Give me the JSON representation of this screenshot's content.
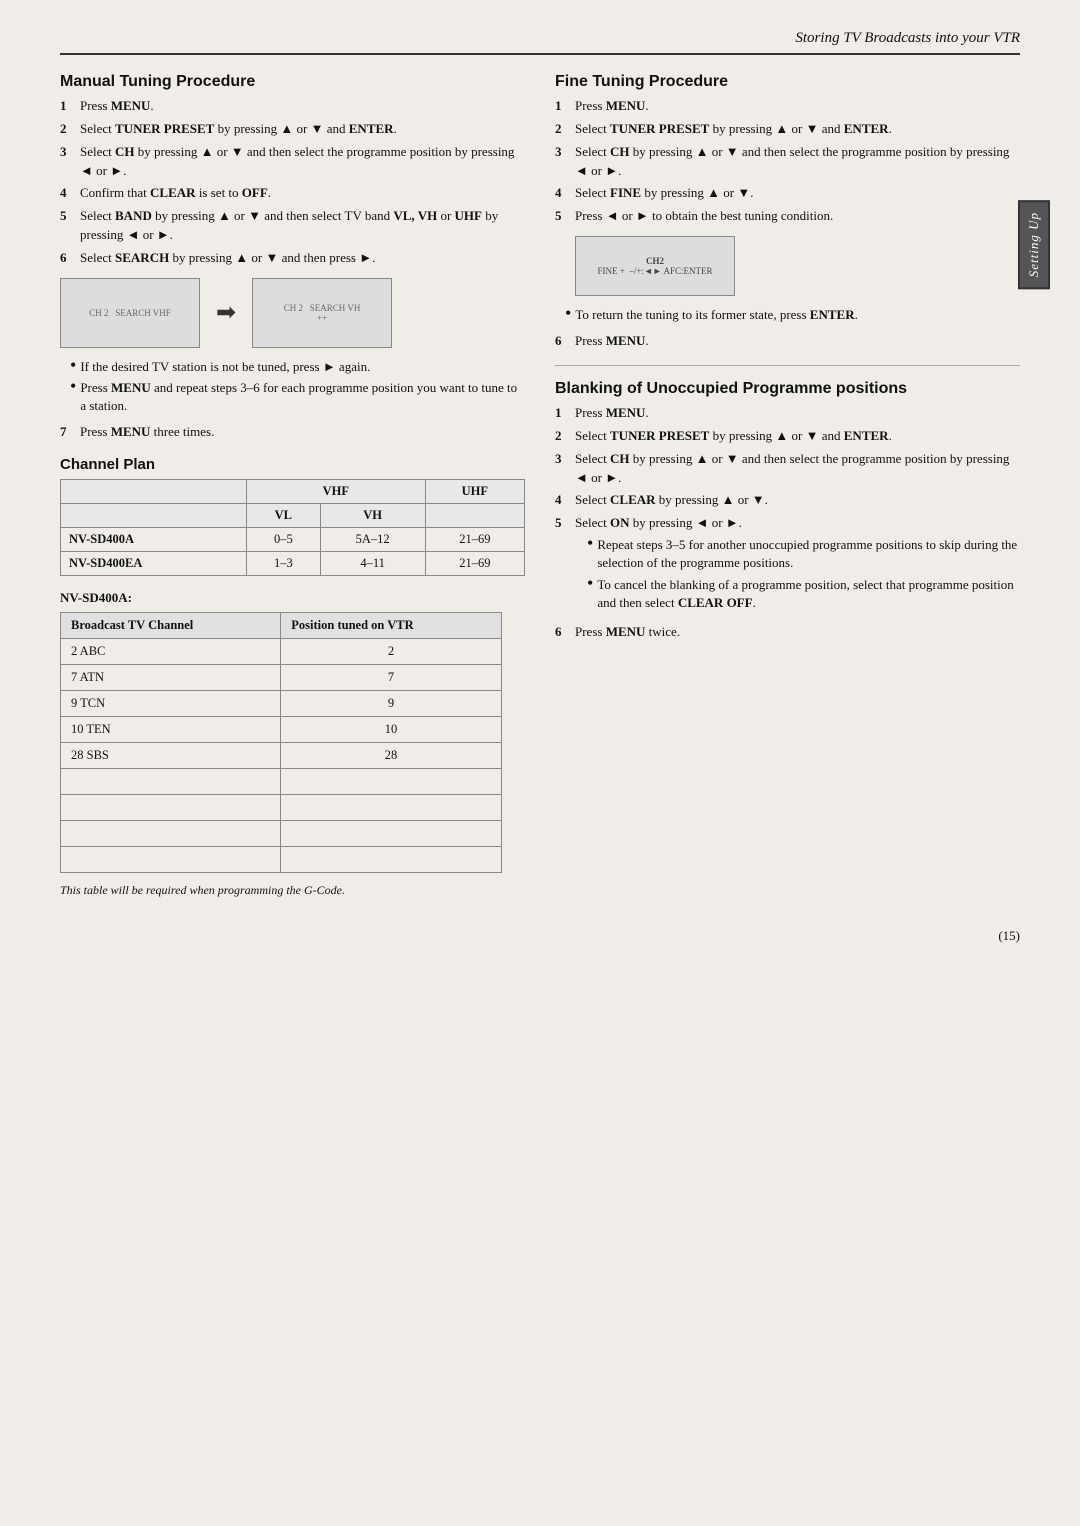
{
  "page": {
    "header_title": "Storing TV Broadcasts into your VTR",
    "page_number": "(15)"
  },
  "side_tab": {
    "label": "Setting Up"
  },
  "manual_tuning": {
    "title": "Manual Tuning Procedure",
    "steps": [
      {
        "num": "1",
        "text": "Press ",
        "bold": "MENU",
        "rest": "."
      },
      {
        "num": "2",
        "text": "Select ",
        "bold": "TUNER PRESET",
        "rest": " by pressing ▲ or ▼ and ",
        "bold2": "ENTER",
        "rest2": "."
      },
      {
        "num": "3",
        "text": "Select ",
        "bold": "CH",
        "rest": " by pressing ▲ or ▼ and then select the programme position by pressing ◄ or ►."
      },
      {
        "num": "4",
        "text": "Confirm that ",
        "bold": "CLEAR",
        "rest": " is set to ",
        "bold2": "OFF",
        "rest2": "."
      },
      {
        "num": "5",
        "text": "Select ",
        "bold": "BAND",
        "rest": " by pressing ▲ or ▼ and then select TV band ",
        "bold2": "VL, VH",
        "rest2": " or ",
        "bold3": "UHF",
        "rest3": " by pressing ◄ or ►."
      },
      {
        "num": "6",
        "text": "Select ",
        "bold": "SEARCH",
        "rest": " by pressing ▲ or ▼ and then press ►."
      }
    ],
    "screen_label_left": "CH 2  SEARCH VHF",
    "screen_label_right": "CH 2  SEARCH VH",
    "screen_sublabel_right": "++",
    "bullet1": "If the desired TV station is not be tuned, press ► again.",
    "bullet2": "Press ",
    "bullet2_bold": "MENU",
    "bullet2_rest": " and repeat steps 3–6 for each programme position you want to tune to a station.",
    "step7": {
      "num": "7",
      "text": "Press ",
      "bold": "MENU",
      "rest": " three times."
    }
  },
  "channel_plan": {
    "title": "Channel Plan",
    "table": {
      "headers": [
        "",
        "VHF",
        "",
        "UHF"
      ],
      "subheaders": [
        "",
        "VL",
        "VH",
        ""
      ],
      "rows": [
        {
          "model": "NV-SD400A",
          "vl": "0–5",
          "vh": "5A–12",
          "uhf": "21–69"
        },
        {
          "model": "NV-SD400EA",
          "vl": "1–3",
          "vh": "4–11",
          "uhf": "21–69"
        }
      ]
    },
    "model_label": "NV-SD400A:",
    "broadcast_table": {
      "headers": [
        "Broadcast TV Channel",
        "Position tuned on VTR"
      ],
      "rows": [
        {
          "channel": "2 ABC",
          "position": "2"
        },
        {
          "channel": "7 ATN",
          "position": "7"
        },
        {
          "channel": "9 TCN",
          "position": "9"
        },
        {
          "channel": "10 TEN",
          "position": "10"
        },
        {
          "channel": "28 SBS",
          "position": "28"
        },
        {
          "channel": "",
          "position": ""
        },
        {
          "channel": "",
          "position": ""
        },
        {
          "channel": "",
          "position": ""
        },
        {
          "channel": "",
          "position": ""
        }
      ]
    },
    "table_note": "This table will be required when programming the G-Code."
  },
  "fine_tuning": {
    "title": "Fine Tuning Procedure",
    "steps": [
      {
        "num": "1",
        "text": "Press ",
        "bold": "MENU",
        "rest": "."
      },
      {
        "num": "2",
        "text": "Select ",
        "bold": "TUNER PRESET",
        "rest": " by pressing ▲ or ▼ and ",
        "bold2": "ENTER",
        "rest2": "."
      },
      {
        "num": "3",
        "text": "Select ",
        "bold": "CH",
        "rest": " by pressing ▲ or ▼ and then select the programme position by pressing ◄ or ►."
      },
      {
        "num": "4",
        "text": "Select ",
        "bold": "FINE",
        "rest": " by pressing ▲ or ▼."
      },
      {
        "num": "5",
        "text": "Press ◄ or ► to obtain the best tuning condition."
      }
    ],
    "screen_text": "CH2\nFINE +  –/+:◄► AFC:ENTER",
    "bullet_return": "To return the tuning to its former state, press ",
    "bullet_return_bold": "ENTER",
    "bullet_return_rest": ".",
    "step6": {
      "num": "6",
      "text": "Press ",
      "bold": "MENU",
      "rest": "."
    }
  },
  "blanking": {
    "title": "Blanking of Unoccupied Programme positions",
    "steps": [
      {
        "num": "1",
        "text": "Press ",
        "bold": "MENU",
        "rest": "."
      },
      {
        "num": "2",
        "text": "Select ",
        "bold": "TUNER PRESET",
        "rest": " by pressing ▲ or ▼ and ",
        "bold2": "ENTER",
        "rest2": "."
      },
      {
        "num": "3",
        "text": "Select ",
        "bold": "CH",
        "rest": " by pressing ▲ or ▼ and then select the programme position by pressing ◄ or ►."
      },
      {
        "num": "4",
        "text": "Select ",
        "bold": "CLEAR",
        "rest": " by pressing ▲ or ▼."
      },
      {
        "num": "5",
        "text": "Select ",
        "bold": "ON",
        "rest": " by pressing ◄ or ►."
      }
    ],
    "sub_bullet1": "Repeat steps 3–5 for another unoccupied programme positions to skip during the selection of the programme positions.",
    "sub_bullet2": "To cancel the blanking of a programme position, select that programme position and then select ",
    "sub_bullet2_bold": "CLEAR OFF",
    "sub_bullet2_rest": ".",
    "step6": {
      "num": "6",
      "text": "Press ",
      "bold": "MENU",
      "rest": " twice."
    }
  }
}
